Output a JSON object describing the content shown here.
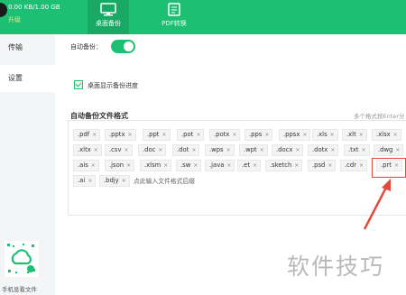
{
  "header": {
    "storage": "0.00 KB/1.00 GB",
    "upgrade": "升级",
    "tabs": [
      {
        "label": "桌面备份",
        "icon": "monitor-icon",
        "active": true
      },
      {
        "label": "PDF转换",
        "icon": "pdf-convert-icon",
        "active": false
      }
    ],
    "accent": "#1dbf73"
  },
  "sidebar": {
    "items": [
      {
        "label": "传输"
      },
      {
        "label": "设置"
      }
    ],
    "qr_caption": "手机息看文件"
  },
  "main": {
    "auto_backup_label": "自动备份：",
    "auto_backup_on": true,
    "show_progress_label": "桌面显示备份进度",
    "show_progress_checked": true,
    "formats_title": "自动备份文件格式",
    "formats_hint": "多个格式按Enter分",
    "tags": [
      ".pdf",
      ".pptx",
      ".ppt",
      ".pot",
      ".potx",
      ".pps",
      ".ppsx",
      ".xls",
      ".xlt",
      ".xlsx",
      ".xltx",
      ".csv",
      ".doc",
      ".dot",
      ".wps",
      ".wpt",
      ".docx",
      ".dotx",
      ".txt",
      ".dwg",
      ".ais",
      ".json",
      ".xlsm",
      ".sw",
      ".java",
      ".et",
      ".sketch",
      ".psd",
      ".cdr",
      ".prt",
      ".ai",
      ".bdjy"
    ],
    "tag_input_placeholder": "点此输入文件格式后缀"
  },
  "watermark": "软件技巧"
}
